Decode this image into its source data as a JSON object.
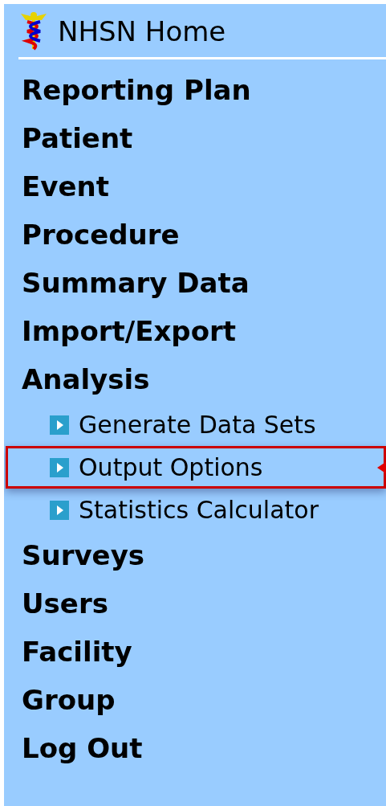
{
  "home": {
    "label": "NHSN Home"
  },
  "menu": [
    {
      "label": "Reporting Plan"
    },
    {
      "label": "Patient"
    },
    {
      "label": "Event"
    },
    {
      "label": "Procedure"
    },
    {
      "label": "Summary Data"
    },
    {
      "label": "Import/Export"
    },
    {
      "label": "Analysis",
      "children": [
        {
          "label": "Generate Data Sets",
          "highlighted": false
        },
        {
          "label": "Output Options",
          "highlighted": true
        },
        {
          "label": "Statistics Calculator",
          "highlighted": false
        }
      ]
    },
    {
      "label": "Surveys"
    },
    {
      "label": "Users"
    },
    {
      "label": "Facility"
    },
    {
      "label": "Group"
    },
    {
      "label": "Log Out"
    }
  ]
}
